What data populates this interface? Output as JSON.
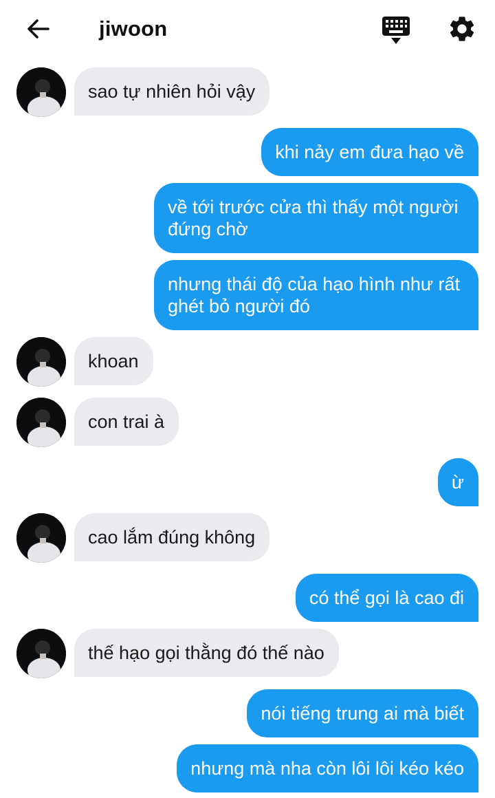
{
  "header": {
    "title": "jiwoon"
  },
  "icons": {
    "back": "arrow-left-icon",
    "keyboard": "keyboard-hide-icon",
    "settings": "gear-icon"
  },
  "colors": {
    "outgoing": "#1b9bf0",
    "incoming": "#e9ebef"
  },
  "messages": [
    {
      "from": "contact",
      "text": "sao tự nhiên hỏi vậy"
    },
    {
      "from": "me",
      "text": "khi nảy em đưa hạo về"
    },
    {
      "from": "me",
      "text": "về tới trước cửa thì thấy một người đứng chờ"
    },
    {
      "from": "me",
      "text": "nhưng thái độ của hạo hình như rất ghét bỏ người đó"
    },
    {
      "from": "contact",
      "text": "khoan"
    },
    {
      "from": "contact",
      "text": "con trai à"
    },
    {
      "from": "me",
      "text": "ừ"
    },
    {
      "from": "contact",
      "text": "cao lắm đúng không"
    },
    {
      "from": "me",
      "text": "có thể gọi là cao đi"
    },
    {
      "from": "contact",
      "text": "thế hạo gọi thằng đó thế nào"
    },
    {
      "from": "me",
      "text": "nói tiếng trung ai mà biết"
    },
    {
      "from": "me",
      "text": "nhưng mà nha còn lôi lôi kéo kéo"
    }
  ]
}
